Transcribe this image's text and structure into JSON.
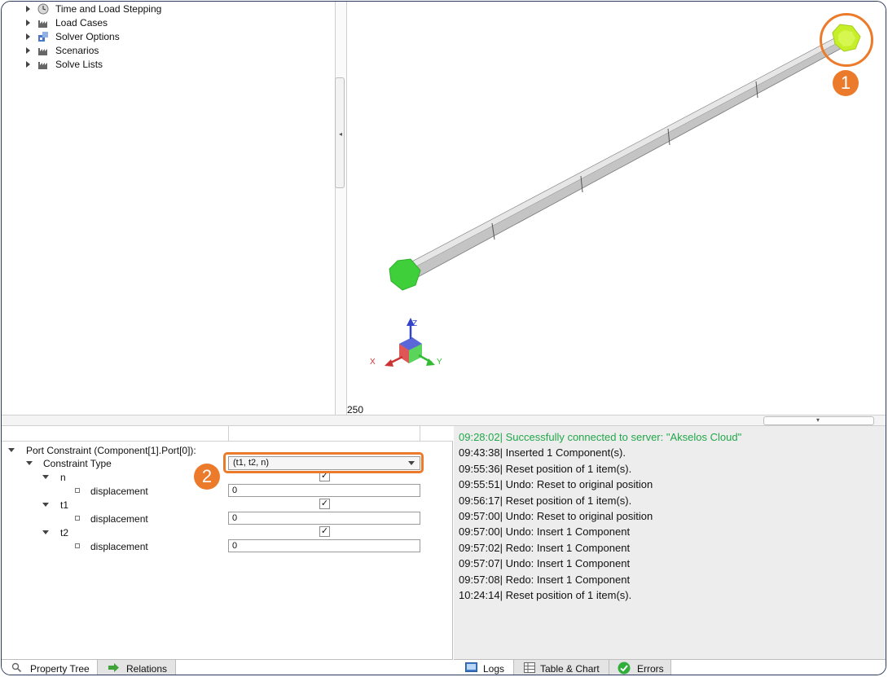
{
  "tree": {
    "items": [
      {
        "label": "Time and Load Stepping",
        "icon": "clock-icon"
      },
      {
        "label": "Load Cases",
        "icon": "factory-icon"
      },
      {
        "label": "Solver Options",
        "icon": "solver-options-icon"
      },
      {
        "label": "Scenarios",
        "icon": "factory-icon"
      },
      {
        "label": "Solve Lists",
        "icon": "factory-icon"
      }
    ]
  },
  "viewport": {
    "zoom_readout": "250",
    "axis_labels": {
      "x": "X",
      "y": "Y",
      "z": "Z"
    },
    "colors": {
      "beam": "#c8c8c8",
      "port_selected": "#c6ef2a",
      "port": "#3ecf3a"
    }
  },
  "property_tree": {
    "root_label": "Port Constraint (Component[1].Port[0]):",
    "constraint_type_label": "Constraint Type",
    "constraint_type_value": "(t1, t2, n)",
    "groups": [
      {
        "name": "n",
        "checked": true,
        "field_label": "displacement",
        "value": "0"
      },
      {
        "name": "t1",
        "checked": true,
        "field_label": "displacement",
        "value": "0"
      },
      {
        "name": "t2",
        "checked": true,
        "field_label": "displacement",
        "value": "0"
      }
    ],
    "check_glyph": "✓"
  },
  "logs": [
    {
      "text": "09:28:02| Successfully connected to server: \"Akselos Cloud\"",
      "status": "success"
    },
    {
      "text": "09:43:38| Inserted 1 Component(s).",
      "status": "normal"
    },
    {
      "text": "09:55:36| Reset position of 1 item(s).",
      "status": "normal"
    },
    {
      "text": "09:55:51| Undo: Reset to original position",
      "status": "normal"
    },
    {
      "text": "09:56:17| Reset position of 1 item(s).",
      "status": "normal"
    },
    {
      "text": "09:57:00| Undo: Reset to original position",
      "status": "normal"
    },
    {
      "text": "09:57:00| Undo: Insert 1 Component",
      "status": "normal"
    },
    {
      "text": "09:57:02| Redo: Insert 1 Component",
      "status": "normal"
    },
    {
      "text": "09:57:07| Undo: Insert 1 Component",
      "status": "normal"
    },
    {
      "text": "09:57:08| Redo: Insert 1 Component",
      "status": "normal"
    },
    {
      "text": "10:24:14| Reset position of 1 item(s).",
      "status": "normal"
    }
  ],
  "left_tabs": [
    {
      "label": "Property Tree",
      "icon": "search-icon",
      "active": true
    },
    {
      "label": "Relations",
      "icon": "arrow-right-icon",
      "active": false
    }
  ],
  "right_tabs": [
    {
      "label": "Logs",
      "icon": "logs-icon",
      "active": true
    },
    {
      "label": "Table & Chart",
      "icon": "table-icon",
      "active": false
    },
    {
      "label": "Errors",
      "icon": "check-circle-icon",
      "active": false
    }
  ],
  "callouts": [
    {
      "number": "1"
    },
    {
      "number": "2"
    }
  ],
  "accent_color": "#ec7a2b",
  "success_color": "#21a84a"
}
